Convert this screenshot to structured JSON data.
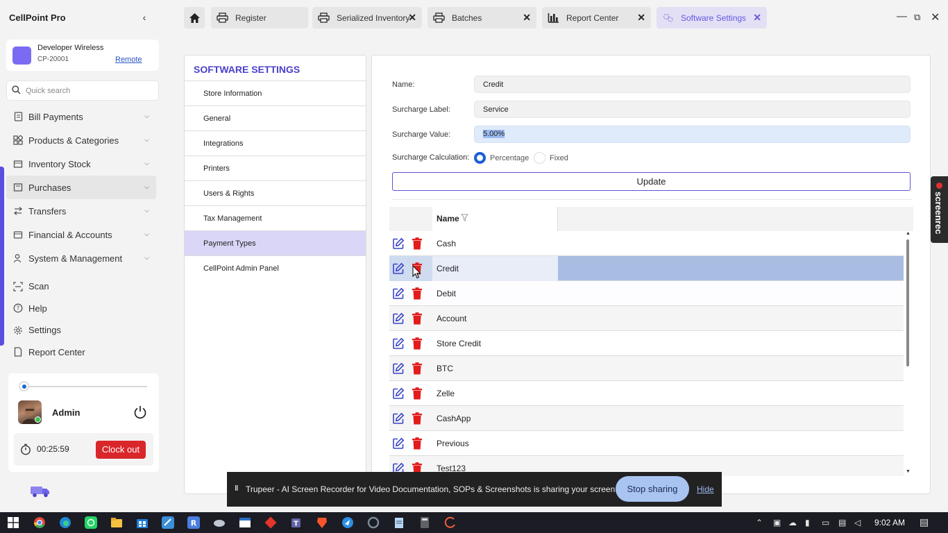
{
  "app": {
    "title": "CellPoint Pro"
  },
  "store": {
    "name": "Developer Wireless",
    "code": "CP-20001",
    "remote_link": "Remote"
  },
  "search": {
    "placeholder": "Quick search"
  },
  "nav": {
    "items": [
      {
        "label": "Bill Payments",
        "icon": "receipt-icon"
      },
      {
        "label": "Products & Categories",
        "icon": "grid-icon"
      },
      {
        "label": "Inventory Stock",
        "icon": "box-icon"
      },
      {
        "label": "Purchases",
        "icon": "cart-icon"
      },
      {
        "label": "Transfers",
        "icon": "transfer-icon"
      },
      {
        "label": "Financial & Accounts",
        "icon": "wallet-icon"
      },
      {
        "label": "System & Management",
        "icon": "user-gear-icon"
      }
    ],
    "secondary": [
      {
        "label": "Scan",
        "icon": "scan-icon"
      },
      {
        "label": "Help",
        "icon": "help-icon"
      },
      {
        "label": "Settings",
        "icon": "gear-icon"
      },
      {
        "label": "Report Center",
        "icon": "document-icon"
      }
    ]
  },
  "user": {
    "name": "Admin",
    "timer": "00:25:59",
    "clock_out_label": "Clock out"
  },
  "tabs": [
    {
      "label": "Register",
      "icon": "printer-icon"
    },
    {
      "label": "Serialized Inventory",
      "icon": "printer-icon"
    },
    {
      "label": "Batches",
      "icon": "printer-icon"
    },
    {
      "label": "Report Center",
      "icon": "bar-chart-icon"
    },
    {
      "label": "Software Settings",
      "icon": "settings-icon"
    }
  ],
  "settings": {
    "heading": "SOFTWARE SETTINGS",
    "items": [
      "Store Information",
      "General",
      "Integrations",
      "Printers",
      "Users & Rights",
      "Tax Management",
      "Payment Types",
      "CellPoint Admin Panel"
    ],
    "active_item": "Payment Types"
  },
  "form": {
    "name_label": "Name:",
    "name_value": "Credit",
    "surcharge_label_label": "Surcharge Label:",
    "surcharge_label_value": "Service",
    "surcharge_value_label": "Surcharge Value:",
    "surcharge_value_value": "5.00%",
    "calc_label": "Surcharge Calculation:",
    "calc_options": [
      "Percentage",
      "Fixed"
    ],
    "calc_selected": "Percentage",
    "update_label": "Update"
  },
  "grid": {
    "column_name": "Name",
    "rows": [
      "Cash",
      "Credit",
      "Debit",
      "Account",
      "Store Credit",
      "BTC",
      "Zelle",
      "CashApp",
      "Previous",
      "Test123"
    ],
    "selected_row": "Credit"
  },
  "screenrec": {
    "label": "screenrec"
  },
  "share_bar": {
    "message": "Trupeer - AI Screen Recorder for Video Documentation, SOPs & Screenshots is sharing your screen.",
    "stop_label": "Stop sharing",
    "hide_label": "Hide"
  },
  "taskbar": {
    "time": "9:02 AM"
  },
  "colors": {
    "accent": "#5b4fe0",
    "danger": "#e31b1b",
    "edit": "#3b44c9",
    "selected_row": "#a9bde2"
  }
}
